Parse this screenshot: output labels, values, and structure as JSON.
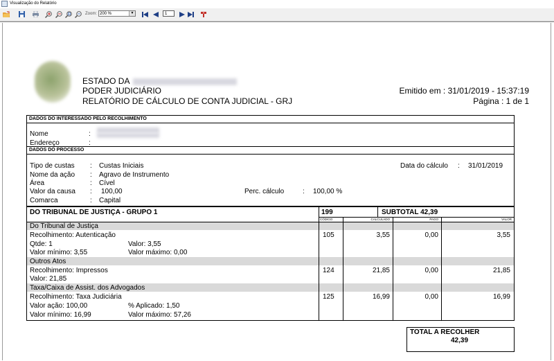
{
  "window": {
    "title": "Visualização do Relatório"
  },
  "toolbar": {
    "zoom_label": "Zoom:",
    "zoom_value": "200 %",
    "page_value": "1"
  },
  "report": {
    "header": {
      "line1": "ESTADO DA",
      "line2": "PODER JUDICIÁRIO",
      "line3": "RELATÓRIO DE CÁLCULO DE CONTA JUDICIAL - GRJ",
      "emitido": "Emitido em : 31/01/2019 - 15:37:19",
      "pagina": "Página : 1 de 1"
    },
    "interessado": {
      "section_title": "DADOS DO INTERESSADO PELO RECOLHIMENTO",
      "nome_label": "Nome",
      "endereco_label": "Endereço",
      "colon": ":"
    },
    "processo": {
      "section_title": "DADOS DO PROCESSO",
      "tipo_label": "Tipo de custas",
      "tipo_value": "Custas Iniciais",
      "acao_label": "Nome da ação",
      "acao_value": "Agravo de Instrumento",
      "area_label": "Área",
      "area_value": "Cível",
      "valor_label": "Valor da causa",
      "valor_value": "100,00",
      "comarca_label": "Comarca",
      "comarca_value": "Capital",
      "perc_label": "Perc. cálculo",
      "perc_value": "100,00 %",
      "data_label": "Data do cálculo",
      "data_value": "31/01/2019",
      "colon": ":"
    },
    "grupo": {
      "title": "DO TRIBUNAL DE JUSTIÇA - GRUPO 1",
      "code": "199",
      "subtotal": "SUBTOTAL  42,39",
      "col_codigo": "CÓDIGO",
      "col_calculado": "CALCULADO",
      "col_pago": "PAGO",
      "col_valor": "VALOR"
    },
    "sections": [
      {
        "title": "Do Tribunal de Justiça",
        "item": "Recolhimento: Autenticação",
        "detail1a": "Qtde: 1",
        "detail1b": "Valor: 3,55",
        "detail2a": "Valor mínimo: 3,55",
        "detail2b": "Valor máximo: 0,00",
        "codigo": "105",
        "calculado": "3,55",
        "pago": "0,00",
        "valor": "3,55"
      },
      {
        "title": "Outros Atos",
        "item": "Recolhimento: Impressos",
        "detail1a": "Valor: 21,85",
        "codigo": "124",
        "calculado": "21,85",
        "pago": "0,00",
        "valor": "21,85"
      },
      {
        "title": "Taxa/Caixa de Assist. dos Advogados",
        "item": "Recolhimento: Taxa Judiciária",
        "detail1a": "Valor ação: 100,00",
        "detail1b": "% Aplicado: 1,50",
        "detail2a": "Valor mínimo: 16,99",
        "detail2b": "Valor máximo: 57,26",
        "codigo": "125",
        "calculado": "16,99",
        "pago": "0,00",
        "valor": "16,99"
      }
    ],
    "total": {
      "label": "TOTAL A RECOLHER",
      "value": "42,39"
    }
  }
}
